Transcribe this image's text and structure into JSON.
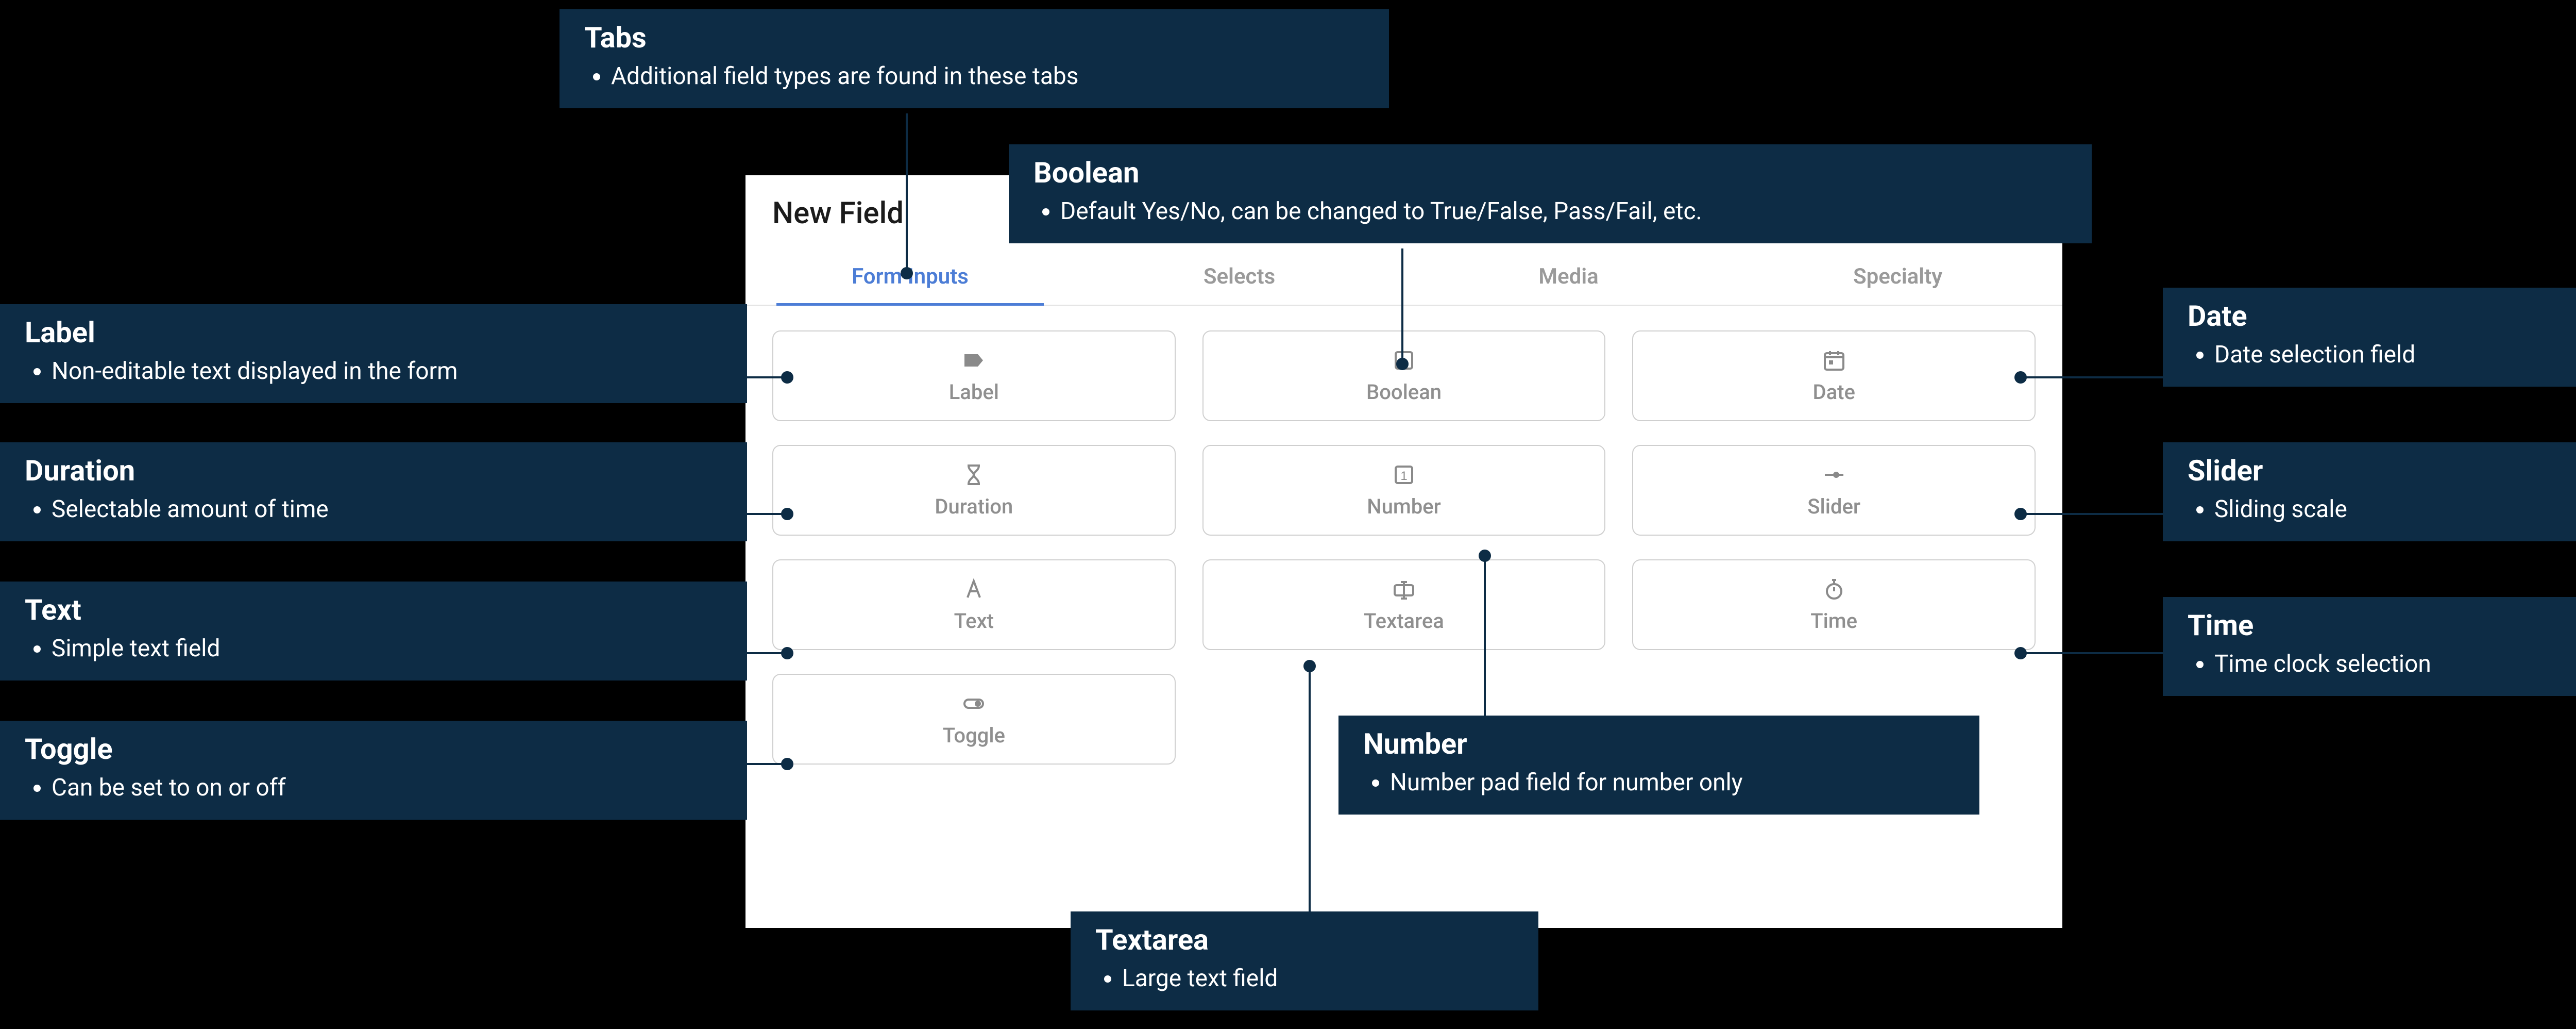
{
  "panel": {
    "title": "New Field",
    "tabs": [
      "Form Inputs",
      "Selects",
      "Media",
      "Specialty"
    ],
    "active_tab_index": 0,
    "fields": [
      {
        "id": "label",
        "label": "Label"
      },
      {
        "id": "boolean",
        "label": "Boolean"
      },
      {
        "id": "date",
        "label": "Date"
      },
      {
        "id": "duration",
        "label": "Duration"
      },
      {
        "id": "number",
        "label": "Number"
      },
      {
        "id": "slider",
        "label": "Slider"
      },
      {
        "id": "text",
        "label": "Text"
      },
      {
        "id": "textarea",
        "label": "Textarea"
      },
      {
        "id": "time",
        "label": "Time"
      },
      {
        "id": "toggle",
        "label": "Toggle"
      }
    ]
  },
  "callouts": {
    "tabs": {
      "title": "Tabs",
      "desc": "Additional field types are found in these tabs"
    },
    "boolean": {
      "title": "Boolean",
      "desc": "Default Yes/No, can be changed to True/False, Pass/Fail, etc."
    },
    "label": {
      "title": "Label",
      "desc": "Non-editable text displayed in the form"
    },
    "date": {
      "title": "Date",
      "desc": "Date selection field"
    },
    "duration": {
      "title": "Duration",
      "desc": "Selectable amount of time"
    },
    "slider": {
      "title": "Slider",
      "desc": "Sliding scale"
    },
    "text": {
      "title": "Text",
      "desc": "Simple text field"
    },
    "time": {
      "title": "Time",
      "desc": "Time clock selection"
    },
    "toggle": {
      "title": "Toggle",
      "desc": "Can be set to on or off"
    },
    "number": {
      "title": "Number",
      "desc": "Number pad field for number only"
    },
    "textarea": {
      "title": "Textarea",
      "desc": "Large text field"
    }
  },
  "colors": {
    "callout_bg": "#0d2c45",
    "accent": "#4c7dd6",
    "muted": "#8f8f8f"
  }
}
